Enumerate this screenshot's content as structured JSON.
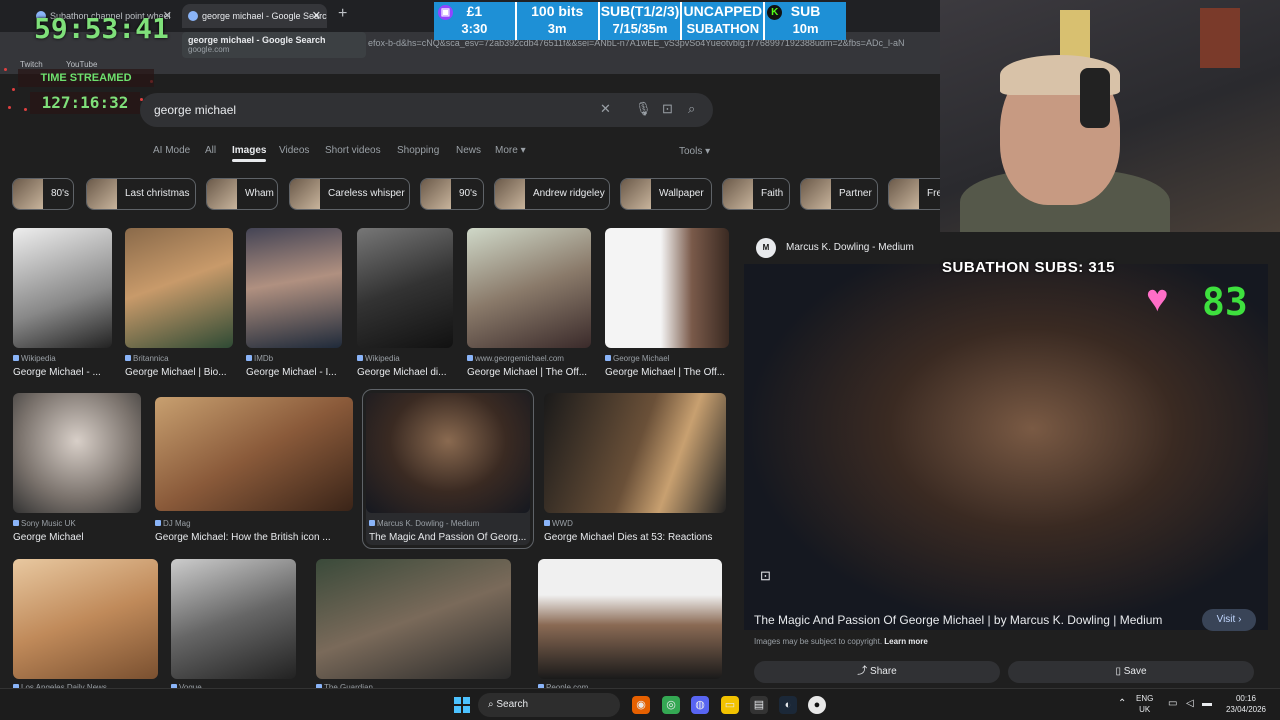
{
  "browser": {
    "tabs": [
      {
        "label": "Subathon channel point wheel"
      },
      {
        "label": "george michael - Google Search"
      }
    ],
    "new_tab": "+",
    "url": "efox-b-d&hs=cNQ&sca_esv=72ab392cdb476511f&&sei=ANbL-n7A1wEE_vS3pvSo4Yueotvblg.f7768997192388udm=2&fbs=ADc_l-aN",
    "tooltip": {
      "title": "george michael - Google Search",
      "domain": "google.com"
    },
    "bookmarks": [
      "Twitch",
      "YouTube"
    ]
  },
  "overlay": {
    "countdown": "59:53:41",
    "time_streamed_label": "TIME STREAMED",
    "time_streamed_value": "127:16:32",
    "subathon_bar": [
      {
        "line1": "£1",
        "line2": "3:30",
        "badge": "twitch-badge-icon",
        "badge_color": "#9146ff"
      },
      {
        "line1": "100 bits",
        "line2": "3m"
      },
      {
        "line1": "SUB(T1/2/3)",
        "line2": "7/15/35m"
      },
      {
        "line1": "UNCAPPED",
        "line2": "SUBATHON"
      },
      {
        "line1": "SUB",
        "line2": "10m",
        "badge": "kick-badge-icon",
        "badge_text": "K",
        "badge_color": "#111"
      }
    ],
    "bar_color": "#1e90d6",
    "subs_label": "SUBATHON SUBS: 315",
    "heart_glyph": "♥",
    "big_number": "83",
    "big_number_color": "#3ee03e"
  },
  "search": {
    "query": "george michael",
    "tabs": [
      "AI Mode",
      "All",
      "Images",
      "Videos",
      "Short videos",
      "Shopping",
      "News",
      "More"
    ],
    "active_tab": "Images",
    "tools": "Tools",
    "chips": [
      "80's",
      "Last christmas",
      "Wham",
      "Careless whisper",
      "90's",
      "Andrew ridgeley",
      "Wallpaper",
      "Faith",
      "Partner",
      "Fre"
    ]
  },
  "results": {
    "row1": [
      {
        "source": "Wikipedia",
        "title": "George Michael - ..."
      },
      {
        "source": "Britannica",
        "title": "George Michael | Bio..."
      },
      {
        "source": "IMDb",
        "title": "George Michael - I..."
      },
      {
        "source": "Wikipedia",
        "title": "George Michael di..."
      },
      {
        "source": "www.georgemichael.com",
        "title": "George Michael | The Off..."
      },
      {
        "source": "George Michael",
        "title": "George Michael | The Off..."
      }
    ],
    "row2": [
      {
        "source": "Sony Music UK",
        "title": "George Michael"
      },
      {
        "source": "DJ Mag",
        "title": "George Michael: How the British icon ..."
      },
      {
        "source": "Marcus K. Dowling - Medium",
        "title": "The Magic And Passion Of Georg..."
      },
      {
        "source": "WWD",
        "title": "George Michael Dies at 53: Reactions"
      }
    ],
    "row3": [
      {
        "source": "Los Angeles Daily News"
      },
      {
        "source": "Vogue"
      },
      {
        "source": "The Guardian"
      },
      {
        "source": "People.com"
      }
    ]
  },
  "panel": {
    "logo_text": "M",
    "source": "Marcus K. Dowling - Medium",
    "title": "The Magic And Passion Of George Michael | by Marcus K. Dowling | Medium",
    "visit": "Visit",
    "copyright": "Images may be subject to copyright.",
    "learn_more": "Learn more",
    "share": "Share",
    "save": "Save"
  },
  "taskbar": {
    "search": "Search",
    "lang_top": "ENG",
    "lang_bottom": "UK",
    "time": "00:16",
    "date": "23/04/2026"
  }
}
